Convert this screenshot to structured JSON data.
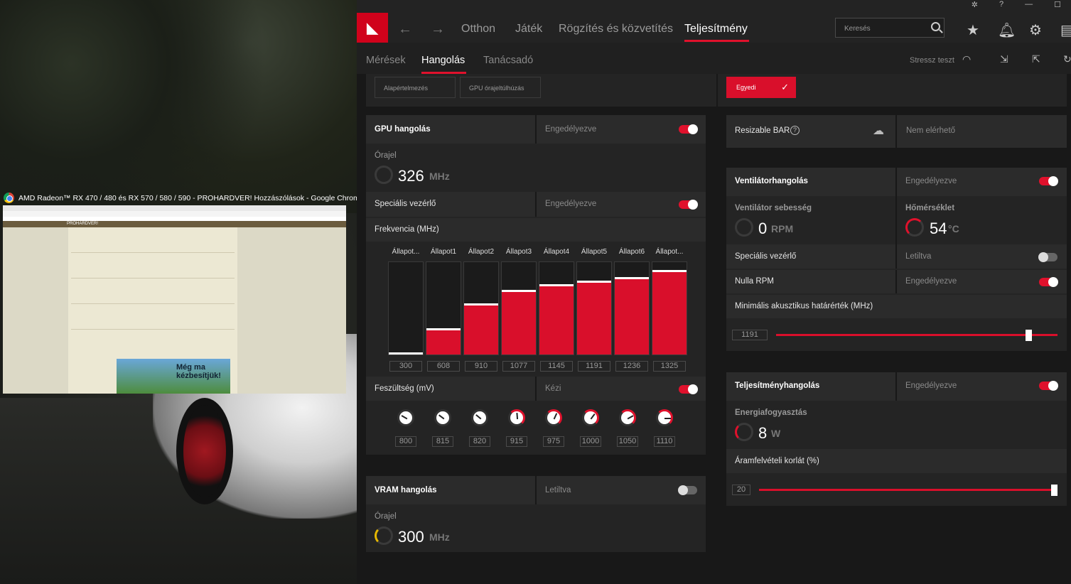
{
  "desktop": {
    "chrome_window_title": "AMD Radeon™ RX 470 / 480 és RX 570 / 580 / 590 - PROHARDVER! Hozzászólások - Google Chrome",
    "thumb_site": "PROHARDVER!",
    "thumb_ad_text": "Még ma kézbesítjük!"
  },
  "app": {
    "title_icons": [
      "bug-icon",
      "help-icon",
      "minimize-icon",
      "maximize-icon"
    ],
    "nav": {
      "tabs": [
        "Otthon",
        "Játék",
        "Rögzítés és közvetítés",
        "Teljesítmény"
      ],
      "active": "Teljesítmény"
    },
    "search": {
      "placeholder": "Keresés"
    },
    "subnav": {
      "tabs": [
        "Mérések",
        "Hangolás",
        "Tanácsadó"
      ],
      "active": "Hangolás",
      "stress_test": "Stressz teszt"
    },
    "presets": {
      "default": "Alapértelmezés",
      "gpu_oc": "GPU órajeltúlhúzás",
      "custom": "Egyedi"
    },
    "gpu_tuning": {
      "title": "GPU hangolás",
      "status": "Engedélyezve",
      "clock_label": "Órajel",
      "clock_value": "326",
      "clock_unit": "MHz",
      "advanced_label": "Speciális vezérlő",
      "advanced_status": "Engedélyezve",
      "freq_label": "Frekvencia (MHz)",
      "states": [
        "Állapot...",
        "Állapot1",
        "Állapot2",
        "Állapot3",
        "Állapot4",
        "Állapot5",
        "Állapot6",
        "Állapot..."
      ],
      "freq_values": [
        300,
        608,
        910,
        1077,
        1145,
        1191,
        1236,
        1325
      ],
      "freq_max": 1400,
      "voltage_label": "Feszültség (mV)",
      "voltage_status": "Kézi",
      "voltages": [
        800,
        815,
        820,
        915,
        975,
        1000,
        1050,
        1110
      ]
    },
    "vram_tuning": {
      "title": "VRAM hangolás",
      "status": "Letiltva",
      "clock_label": "Órajel",
      "clock_value": "300",
      "clock_unit": "MHz"
    },
    "resizable_bar": {
      "label": "Resizable BAR",
      "status": "Nem elérhető"
    },
    "fan_tuning": {
      "title": "Ventilátorhangolás",
      "status": "Engedélyezve",
      "speed_label": "Ventilátor sebesség",
      "speed_value": "0",
      "speed_unit": "RPM",
      "temp_label": "Hőmérséklet",
      "temp_value": "54",
      "temp_unit": "°C",
      "advanced_label": "Speciális vezérlő",
      "advanced_status": "Letiltva",
      "zero_rpm_label": "Nulla RPM",
      "zero_rpm_status": "Engedélyezve",
      "min_acoustic_label": "Minimális akusztikus határérték (MHz)",
      "min_acoustic_value": "1191",
      "min_acoustic_fraction": 0.97
    },
    "power_tuning": {
      "title": "Teljesítményhangolás",
      "status": "Engedélyezve",
      "power_label": "Energiafogyasztás",
      "power_value": "8",
      "power_unit": "W",
      "limit_label": "Áramfelvételi korlát (%)",
      "limit_value": "20",
      "limit_fraction": 1.0
    },
    "colors": {
      "accent": "#e0112c",
      "bg": "#181818",
      "panel": "#242424"
    }
  }
}
